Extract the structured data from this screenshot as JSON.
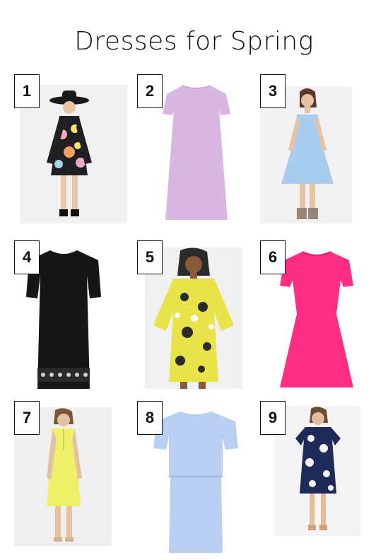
{
  "title": "Dresses for Spring",
  "items": [
    {
      "number": "1",
      "colors": {
        "dress": "#1f1f24",
        "accent": "#f2a7c9",
        "bg": "#f1f1f1"
      }
    },
    {
      "number": "2",
      "colors": {
        "dress": "#d8b8e3",
        "bg": "#ffffff"
      }
    },
    {
      "number": "3",
      "colors": {
        "dress": "#a9cdee",
        "bg": "#f2f2f2"
      }
    },
    {
      "number": "4",
      "colors": {
        "dress": "#161616",
        "bg": "#ffffff"
      }
    },
    {
      "number": "5",
      "colors": {
        "dress": "#e9e34a",
        "accent": "#2b2b2b",
        "bg": "#f0f0f0"
      }
    },
    {
      "number": "6",
      "colors": {
        "dress": "#ff2e83",
        "bg": "#ffffff"
      }
    },
    {
      "number": "7",
      "colors": {
        "dress": "#eef06a",
        "bg": "#efefef"
      }
    },
    {
      "number": "8",
      "colors": {
        "dress": "#b9cff2",
        "bg": "#ffffff"
      }
    },
    {
      "number": "9",
      "colors": {
        "dress": "#1e2a58",
        "accent": "#f5f5f5",
        "bg": "#f4f4f4"
      }
    }
  ]
}
